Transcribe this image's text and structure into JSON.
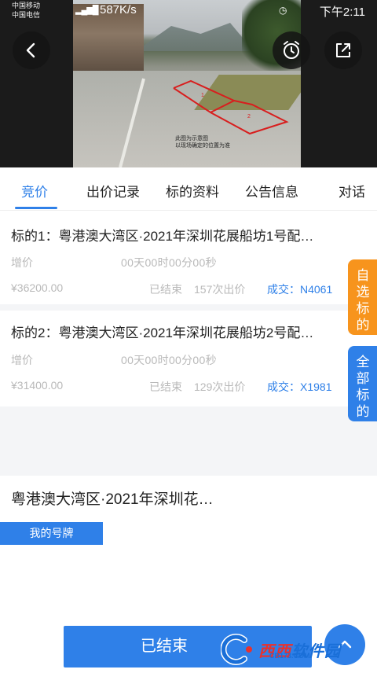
{
  "status_bar": {
    "carrier_1": "中国移动",
    "carrier_2": "中国电信",
    "network_speed": "587K/s",
    "time": "下午2:11"
  },
  "hero": {
    "photo_note_line1": "此图为示意图",
    "photo_note_line2": "以现场确定的位置为准",
    "marker_1": "1",
    "marker_2": "2"
  },
  "tabs": [
    {
      "label": "竞价",
      "active": true
    },
    {
      "label": "出价记录",
      "active": false
    },
    {
      "label": "标的资料",
      "active": false
    },
    {
      "label": "公告信息",
      "active": false
    },
    {
      "label": "对话",
      "active": false
    }
  ],
  "lots": [
    {
      "title": "标的1：粤港澳大湾区·2021年深圳花展船坊1号配…",
      "increment_label": "增价",
      "countdown": "00天00时00分00秒",
      "price": "¥36200.00",
      "status": "已结束",
      "bid_count": "157次出价",
      "deal": "成交：N4061"
    },
    {
      "title": "标的2：粤港澳大湾区·2021年深圳花展船坊2号配…",
      "increment_label": "增价",
      "countdown": "00天00时00分00秒",
      "price": "¥31400.00",
      "status": "已结束",
      "bid_count": "129次出价",
      "deal": "成交：X1981"
    }
  ],
  "side_tabs": {
    "favorites": [
      "自",
      "选",
      "标",
      "的"
    ],
    "all": [
      "全",
      "部",
      "标",
      "的"
    ]
  },
  "bottom": {
    "auction_title": "粤港澳大湾区·2021年深圳花…",
    "my_plate_label": "我的号牌",
    "end_button_label": "已结束"
  },
  "watermark": {
    "brand_part1": "西西",
    "brand_part2": "软件园",
    "url": "CR173.COM"
  },
  "colors": {
    "accent_blue": "#2f80e8",
    "favorite_orange": "#f7941d",
    "muted_text": "#b9b9b9"
  }
}
